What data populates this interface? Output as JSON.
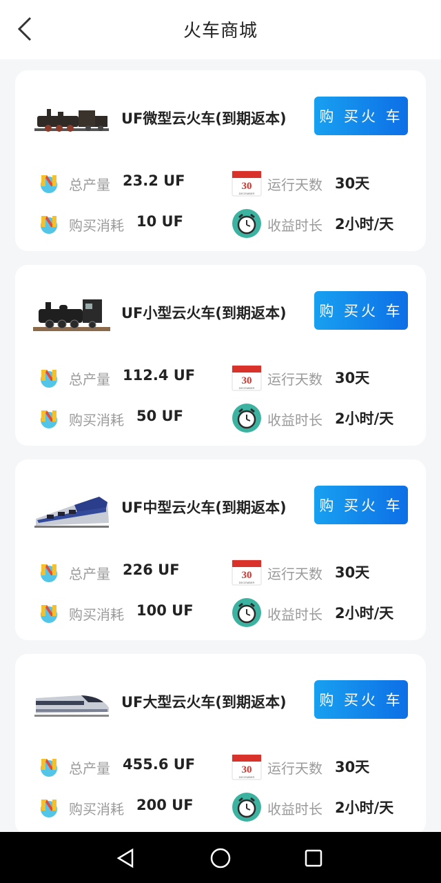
{
  "header": {
    "title": "火车商城",
    "back_icon": "chevron-left-icon"
  },
  "labels": {
    "total_output": "总产量",
    "purchase_cost": "购买消耗",
    "running_days": "运行天数",
    "earning_duration": "收益时长"
  },
  "buy_button_label": "购 买火 车",
  "products": [
    {
      "name": "UF微型云火车(到期返本)",
      "total_output": "23.2 UF",
      "purchase_cost": "10 UF",
      "running_days": "30天",
      "earning_duration": "2小时/天",
      "image": "steam-locomotive-small"
    },
    {
      "name": "UF小型云火车(到期返本)",
      "total_output": "112.4 UF",
      "purchase_cost": "50 UF",
      "running_days": "30天",
      "earning_duration": "2小时/天",
      "image": "steam-locomotive-large"
    },
    {
      "name": "UF中型云火车(到期返本)",
      "total_output": "226 UF",
      "purchase_cost": "100 UF",
      "running_days": "30天",
      "earning_duration": "2小时/天",
      "image": "electric-train"
    },
    {
      "name": "UF大型云火车(到期返本)",
      "total_output": "455.6 UF",
      "purchase_cost": "200 UF",
      "running_days": "30天",
      "earning_duration": "2小时/天",
      "image": "high-speed-train"
    }
  ],
  "calendar_icon": {
    "day": "30",
    "month": "DECEMBER"
  },
  "navbar": {
    "back_icon": "triangle-back-icon",
    "home_icon": "circle-home-icon",
    "recents_icon": "square-recents-icon"
  },
  "colors": {
    "accent_start": "#18a0f0",
    "accent_end": "#0d6fe6",
    "background": "#f5f6f8"
  }
}
